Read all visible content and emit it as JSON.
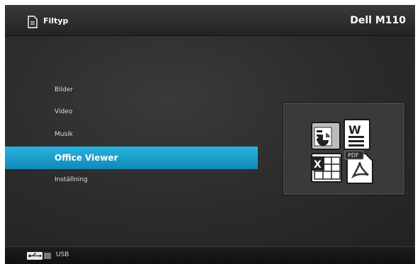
{
  "header": {
    "title": "Filtyp",
    "brand": "Dell M110"
  },
  "menu": {
    "items": [
      {
        "label": "Bilder"
      },
      {
        "label": "Video"
      },
      {
        "label": "Musik"
      },
      {
        "label": "Office Viewer",
        "selected": true
      },
      {
        "label": "Inställning"
      }
    ]
  },
  "preview": {
    "icons": [
      "powerpoint-icon",
      "word-icon",
      "excel-icon",
      "pdf-icon"
    ],
    "pdf_badge": "PDF"
  },
  "footer": {
    "source_label": "USB",
    "icon": "usb-icon"
  },
  "colors": {
    "accent": "#1fa3d1",
    "background": "#2a2a2a"
  }
}
